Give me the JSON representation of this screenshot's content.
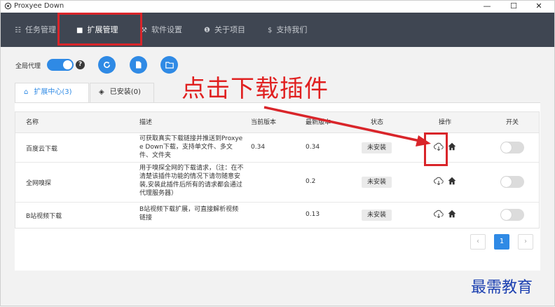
{
  "window": {
    "title": "Proxyee Down",
    "minimize": "—",
    "maximize": "☐",
    "close": "✕"
  },
  "nav": {
    "items": [
      {
        "label": "任务管理",
        "icon": "list-icon"
      },
      {
        "label": "扩展管理",
        "icon": "windows-icon"
      },
      {
        "label": "软件设置",
        "icon": "wrench-icon"
      },
      {
        "label": "关于项目",
        "icon": "info-icon"
      },
      {
        "label": "支持我们",
        "icon": "dollar-icon"
      }
    ]
  },
  "toolbar": {
    "proxy_label": "全局代理",
    "help": "?"
  },
  "annotation": "点击下载插件",
  "tabs": [
    {
      "label": "扩展中心(3)",
      "icon": "store-icon"
    },
    {
      "label": "已安装(0)",
      "icon": "layers-icon"
    }
  ],
  "table": {
    "headers": [
      "名称",
      "描述",
      "当前版本",
      "最新版本",
      "状态",
      "操作",
      "开关"
    ],
    "rows": [
      {
        "name": "百度云下载",
        "desc": "可获取真实下载链接并推送到Proxyee Down下载，支持单文件、多文件、文件夹",
        "current": "0.34",
        "latest": "0.34",
        "status": "未安装"
      },
      {
        "name": "全网嗅探",
        "desc": "用于嗅探全网的下载请求，（注：在不清楚该插件功能的情况下请勿随意安装,安装此插件后所有的请求都会通过代理服务器）",
        "current": "",
        "latest": "0.2",
        "status": "未安装"
      },
      {
        "name": "B站视频下载",
        "desc": "B站视频下载扩展，可直接解析视频链接",
        "current": "",
        "latest": "0.13",
        "status": "未安装"
      }
    ]
  },
  "pager": {
    "prev": "‹",
    "page": "1",
    "next": "›"
  },
  "watermark": "最需教育",
  "colors": {
    "accent": "#2f8ae5",
    "nav_bg": "#3f4652",
    "highlight": "#d9252a"
  }
}
